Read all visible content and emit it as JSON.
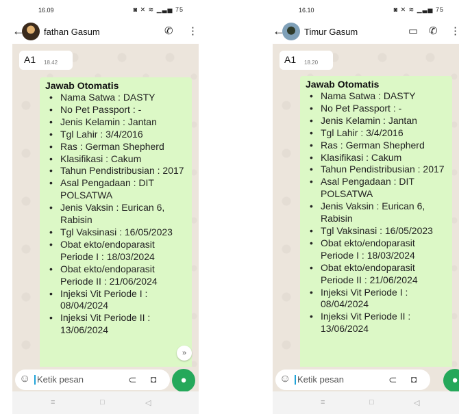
{
  "phones": [
    {
      "status_time": "16.09",
      "status_left_icons": "▣ ⊛",
      "status_right_icons": "◙ ✕ ≋ ▁▃▅ ▭",
      "battery": "75",
      "contact_name": "fathan Gasum",
      "header_icons": [
        "call-add-icon",
        "more-vert-icon"
      ],
      "incoming_text": "A1",
      "incoming_time": "18.42",
      "reply_title": "Jawab Otomatis",
      "reply_items": [
        "Nama Satwa : DASTY",
        "No Pet Passport : -",
        "Jenis Kelamin : Jantan",
        "Tgl Lahir : 3/4/2016",
        "Ras : German Shepherd",
        "Klasifikasi : Cakum",
        "Tahun Pendistribusian : 2017",
        "Asal Pengadaan : DIT POLSATWA",
        "Jenis Vaksin : Eurican 6, Rabisin",
        "Tgl Vaksinasi : 16/05/2023",
        "Obat ekto/endoparasit Periode I : 18/03/2024",
        "Obat ekto/endoparasit Periode II : 21/06/2024",
        "Injeksi Vit Periode I : 08/04/2024",
        "Injeksi Vit Periode II : 13/06/2024"
      ],
      "input_placeholder": "Ketik pesan"
    },
    {
      "status_time": "16.10",
      "status_left_icons": "▣ ⊛",
      "status_right_icons": "◙ ✕ ≋ ▁▃▅ ▭",
      "battery": "75",
      "contact_name": "Timur Gasum",
      "header_icons": [
        "video-call-icon",
        "voice-call-icon",
        "more-vert-icon"
      ],
      "incoming_text": "A1",
      "incoming_time": "18.20",
      "reply_title": "Jawab Otomatis",
      "reply_items": [
        "Nama Satwa : DASTY",
        "No Pet Passport : -",
        "Jenis Kelamin : Jantan",
        "Tgl Lahir : 3/4/2016",
        "Ras : German Shepherd",
        "Klasifikasi : Cakum",
        "Tahun Pendistribusian : 2017",
        "Asal Pengadaan : DIT POLSATWA",
        "Jenis Vaksin : Eurican 6, Rabisin",
        "Tgl Vaksinasi : 16/05/2023",
        "Obat ekto/endoparasit Periode I : 18/03/2024",
        "Obat ekto/endoparasit Periode II : 21/06/2024",
        "Injeksi Vit Periode I : 08/04/2024",
        "Injeksi Vit Periode II : 13/06/2024"
      ],
      "input_placeholder": "Ketik pesan"
    }
  ],
  "colors": {
    "chat_background": "#ece5dc",
    "outgoing_bubble": "#dcf8c6",
    "mic_button": "#25a85a"
  }
}
